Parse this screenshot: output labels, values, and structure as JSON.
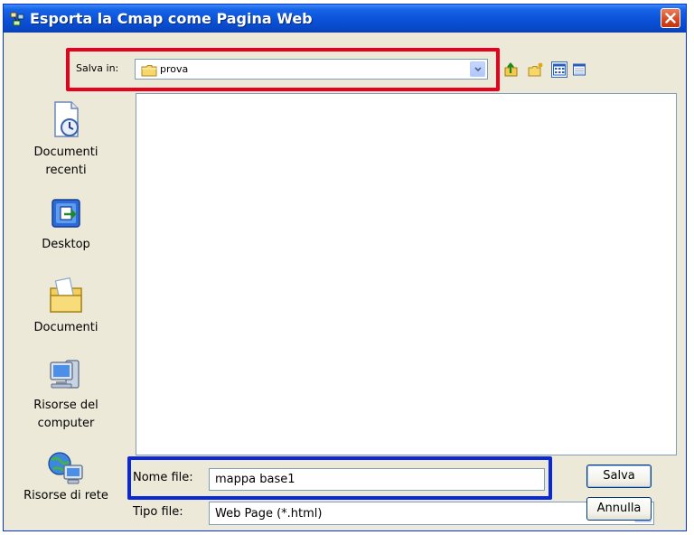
{
  "window": {
    "title": "Esporta la Cmap come Pagina Web",
    "app_icon": "cmap-app-icon",
    "close_icon": "close-icon"
  },
  "look_in": {
    "label": "Salva in:",
    "value": "prova",
    "icon": "folder-icon"
  },
  "toolbar": {
    "items": [
      {
        "name": "up-folder-icon"
      },
      {
        "name": "new-folder-icon"
      },
      {
        "name": "list-view-icon"
      },
      {
        "name": "details-view-icon"
      }
    ]
  },
  "places": [
    {
      "label_line1": "Documenti",
      "label_line2": "recenti",
      "icon": "recent-documents-icon"
    },
    {
      "label_line1": "Desktop",
      "label_line2": "",
      "icon": "desktop-icon"
    },
    {
      "label_line1": "Documenti",
      "label_line2": "",
      "icon": "my-documents-icon"
    },
    {
      "label_line1": "Risorse del",
      "label_line2": "computer",
      "icon": "my-computer-icon"
    },
    {
      "label_line1": "Risorse di rete",
      "label_line2": "",
      "icon": "network-icon"
    }
  ],
  "file_name": {
    "label": "Nome file:",
    "value": "mappa base1"
  },
  "file_type": {
    "label": "Tipo file:",
    "value": "Web Page (*.html)"
  },
  "buttons": {
    "save": "Salva",
    "cancel": "Annulla"
  },
  "colors": {
    "highlight_red": "#e8001c",
    "highlight_blue": "#0a28d8",
    "titlebar": "#0a52d8"
  }
}
